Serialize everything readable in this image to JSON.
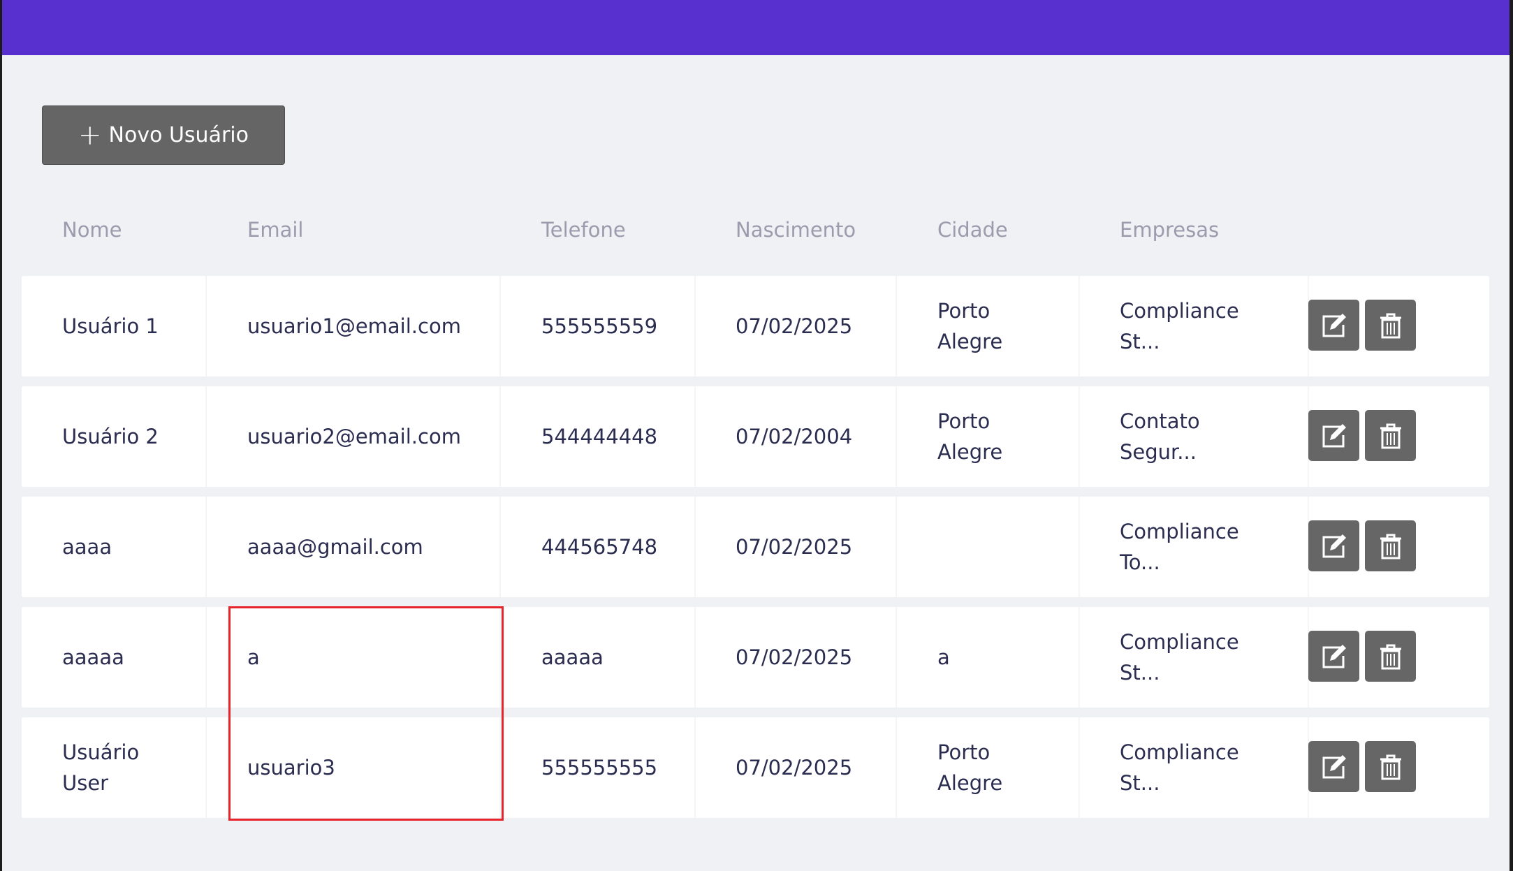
{
  "toolbar": {
    "new_user_label": "Novo Usuário"
  },
  "table": {
    "columns": [
      "Nome",
      "Email",
      "Telefone",
      "Nascimento",
      "Cidade",
      "Empresas"
    ],
    "rows": [
      {
        "nome": "Usuário 1",
        "email": "usuario1@email.com",
        "telefone": "555555559",
        "nascimento": "07/02/2025",
        "cidade": [
          "Porto",
          "Alegre"
        ],
        "empresas": [
          "Compliance",
          "St..."
        ]
      },
      {
        "nome": "Usuário 2",
        "email": "usuario2@email.com",
        "telefone": "544444448",
        "nascimento": "07/02/2004",
        "cidade": [
          "Porto",
          "Alegre"
        ],
        "empresas": [
          "Contato",
          "Segur..."
        ]
      },
      {
        "nome": "aaaa",
        "email": "aaaa@gmail.com",
        "telefone": "444565748",
        "nascimento": "07/02/2025",
        "cidade": [
          "",
          ""
        ],
        "empresas": [
          "Compliance",
          "To..."
        ]
      },
      {
        "nome": "aaaaa",
        "email": "a",
        "telefone": "aaaaa",
        "nascimento": "07/02/2025",
        "cidade": [
          "a",
          ""
        ],
        "empresas": [
          "Compliance",
          "St..."
        ]
      },
      {
        "nome": [
          "Usuário",
          "User"
        ],
        "email": "usuario3",
        "telefone": "555555555",
        "nascimento": "07/02/2025",
        "cidade": [
          "Porto",
          "Alegre"
        ],
        "empresas": [
          "Compliance",
          "St..."
        ]
      }
    ]
  },
  "colors": {
    "topbar": "#5730cf",
    "button": "#656565",
    "background": "#f0f1f4",
    "highlight": "#e8242a"
  },
  "icons": {
    "edit": "edit-icon",
    "delete": "trash-icon",
    "add": "plus-icon"
  }
}
